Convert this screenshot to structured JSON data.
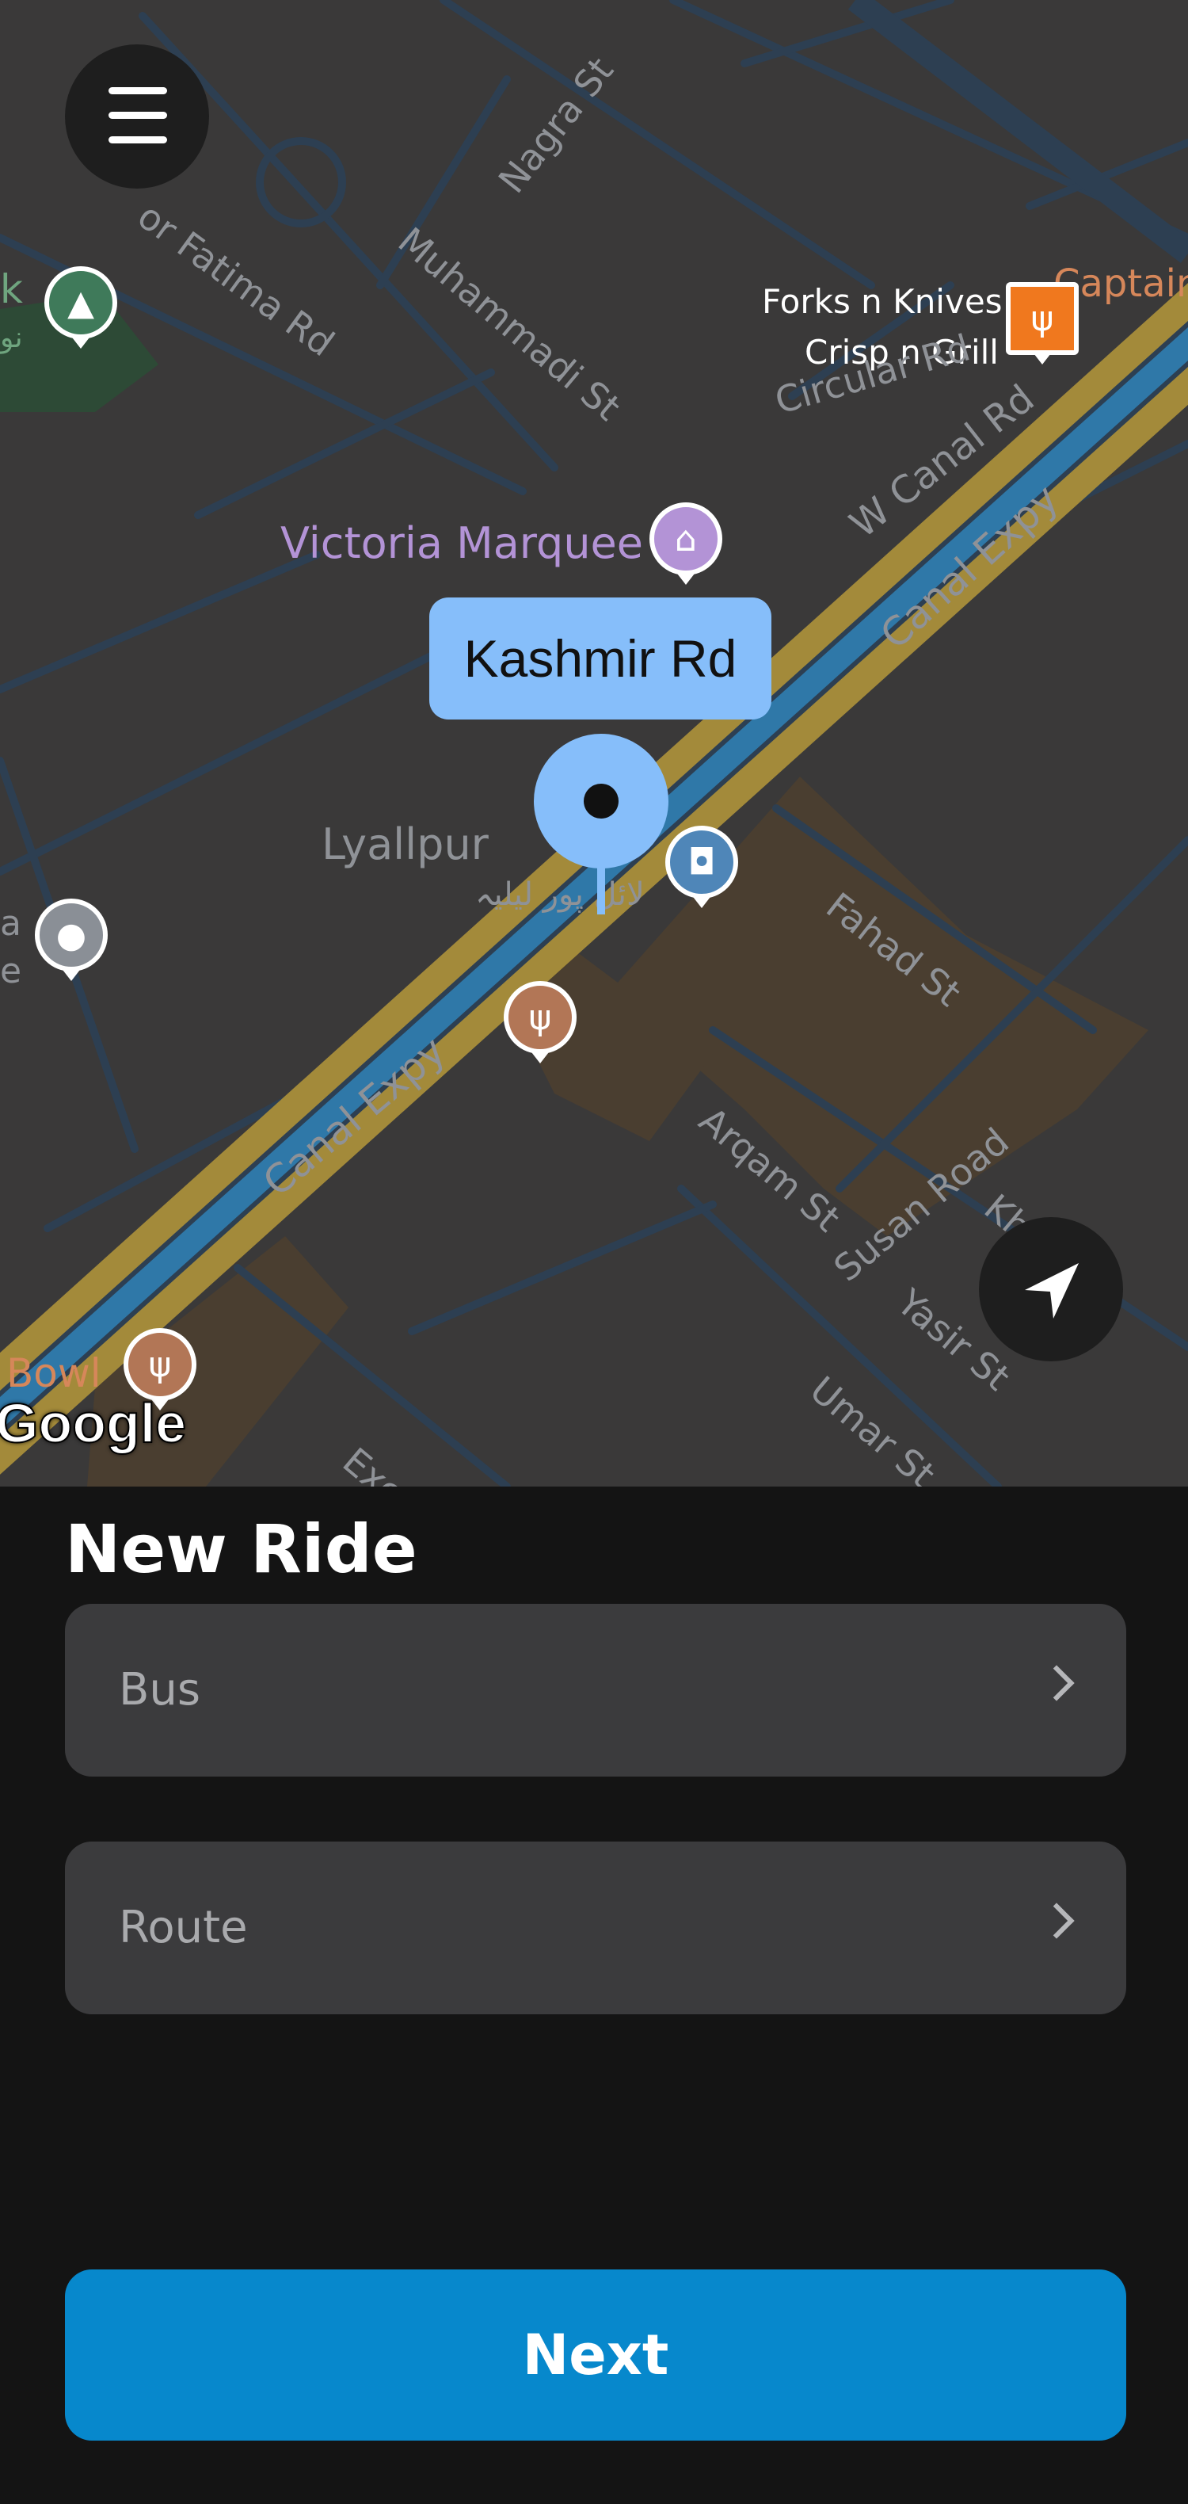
{
  "map": {
    "callout_label": "Kashmir Rd",
    "attribution": "Google",
    "labels": {
      "nagra_st": "Nagra St",
      "muhammadi_st": "Muhammadi St",
      "fatima_rd": "or Fatima Rd",
      "forks_knives": "Forks n Knives",
      "crisp_grill": "Crisp n Grill",
      "captain": "Captain",
      "circular_rd": "Circular Rd",
      "w_canal_rd": "W Canal Rd",
      "canal_expy_upper": "Canal Expy",
      "victoria_marquee": "Victoria Marquee",
      "lyallpur": "Lyallpur",
      "lyallpur_urdu": "لائل پور لیلیہ",
      "fahad_st": "Fahad St",
      "canal_expy_lower": "Canal Expy",
      "arqam_st": "Arqam St",
      "susan_road": "Susan Road",
      "yasir_st": "Yasir St",
      "umar_st": "Umar St",
      "bowl": "Bowl",
      "exce": "Exce",
      "kh": "Kh",
      "left_k": "k",
      "left_urdu": "نو",
      "left_a": "a",
      "left_e": "e"
    },
    "colors": {
      "background": "#3a3939",
      "street": "#2d3f52",
      "highway": "#a38a3a",
      "canal": "#2f78a8",
      "callout": "#86befa"
    }
  },
  "controls": {
    "menu_icon": "hamburger-menu-icon",
    "locate_icon": "navigation-arrow-icon"
  },
  "sheet": {
    "title": "New Ride",
    "bus_placeholder": "Bus",
    "route_placeholder": "Route",
    "next_label": "Next",
    "accent": "#0788cc"
  }
}
